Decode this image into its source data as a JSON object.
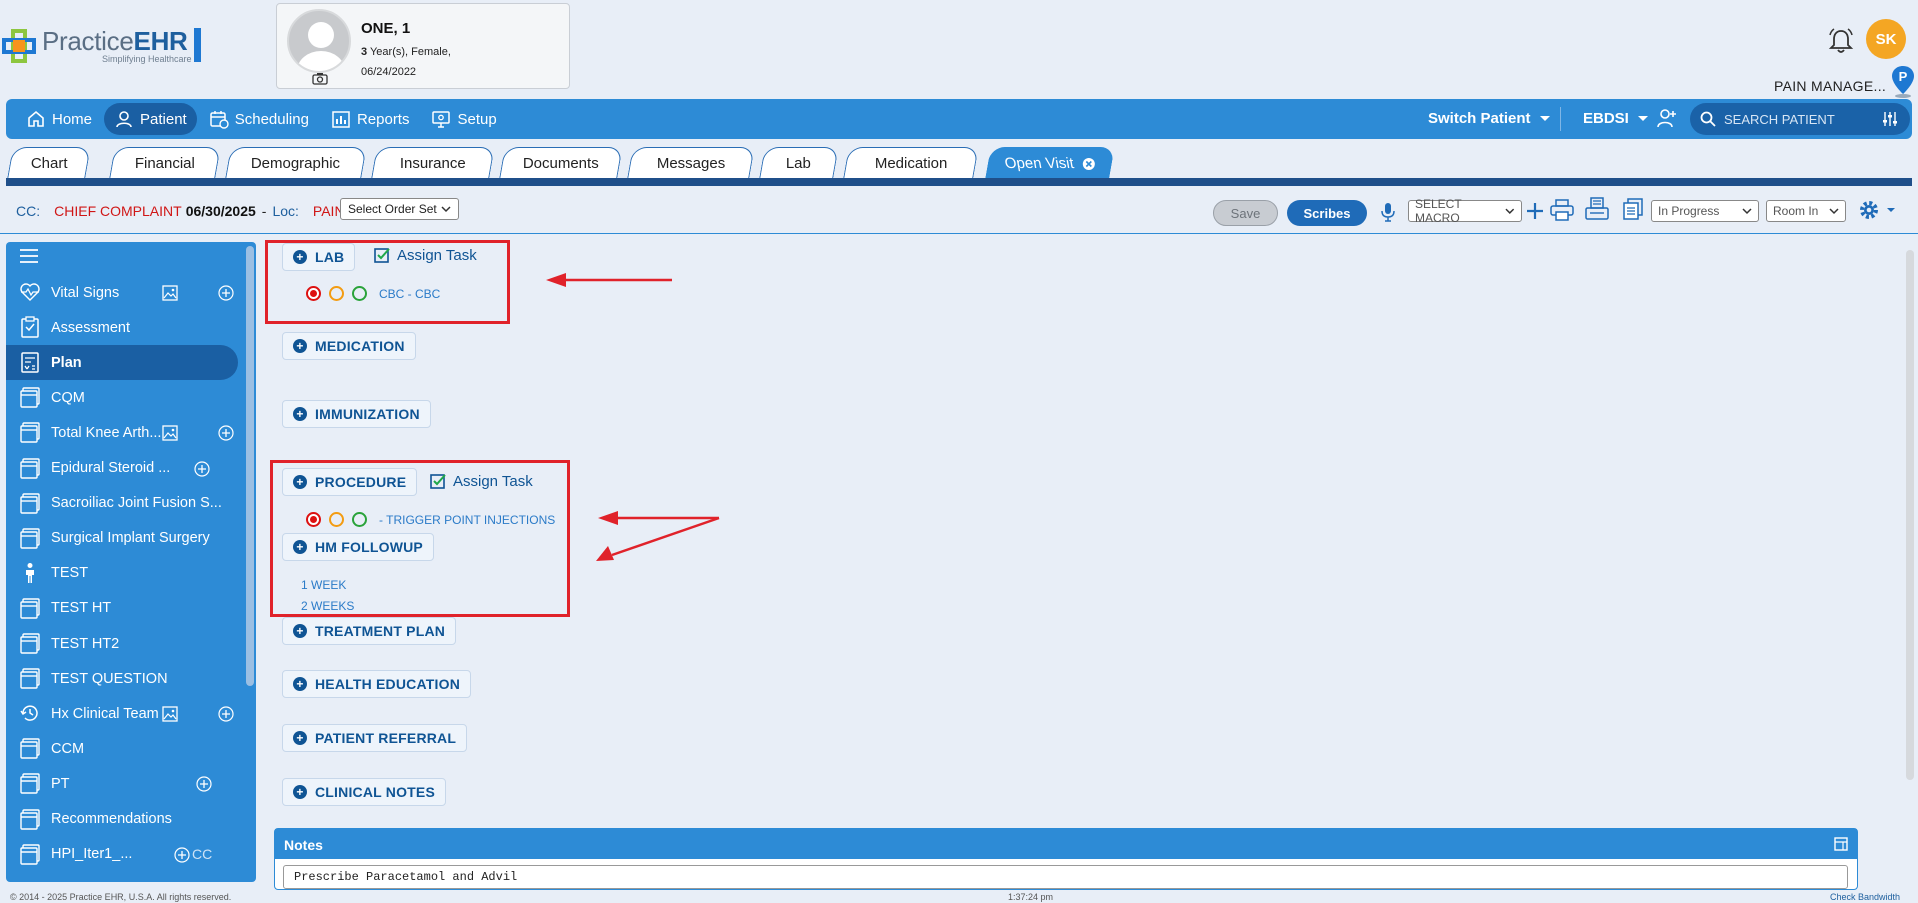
{
  "brand": {
    "name_a": "Practice",
    "name_b": "EHR",
    "tagline": "Simplifying Healthcare"
  },
  "patient": {
    "name": "ONE, 1",
    "age_num": "3",
    "age_rest": " Year(s), ",
    "gender": "Female",
    "dob": "06/24/2022"
  },
  "user": {
    "initials": "SK",
    "practice": "PAIN MANAGE...",
    "pin_letter": "P"
  },
  "nav": {
    "items": [
      {
        "label": "Home",
        "icon": "home-icon"
      },
      {
        "label": "Patient",
        "icon": "patient-icon",
        "active": true
      },
      {
        "label": "Scheduling",
        "icon": "scheduling-icon"
      },
      {
        "label": "Reports",
        "icon": "reports-icon"
      },
      {
        "label": "Setup",
        "icon": "setup-icon"
      }
    ],
    "switch_patient": "Switch Patient",
    "location": "EBDSI",
    "search_placeholder": "SEARCH PATIENT"
  },
  "tabs": [
    "Chart",
    "Financial",
    "Demographic",
    "Insurance",
    "Documents",
    "Messages",
    "Lab",
    "Medication",
    "Open Visit"
  ],
  "toolbar": {
    "cc_label": "CC:",
    "cc_value": "CHIEF COMPLAINT",
    "date": "06/30/2025",
    "dash": "-",
    "loc_label": "Loc:",
    "loc_value": "PAIN",
    "order_set": "Select Order Set",
    "save": "Save",
    "scribes": "Scribes",
    "macro": "SELECT MACRO",
    "status": "In Progress",
    "room": "Room In"
  },
  "sidebar": {
    "items": [
      {
        "label": "Vital Signs",
        "icon": "heartbeat-icon",
        "img": true,
        "plus": true
      },
      {
        "label": "Assessment",
        "icon": "clipboard-icon"
      },
      {
        "label": "Plan",
        "icon": "plan-icon",
        "active": true
      },
      {
        "label": "CQM",
        "icon": "form-icon"
      },
      {
        "label": "Total Knee Arth...",
        "icon": "form-icon",
        "img": true,
        "plus": true
      },
      {
        "label": "Epidural Steroid ...",
        "icon": "form-icon",
        "plus": true
      },
      {
        "label": "Sacroiliac Joint Fusion S...",
        "icon": "form-icon"
      },
      {
        "label": "Surgical Implant Surgery",
        "icon": "form-icon"
      },
      {
        "label": "TEST",
        "icon": "person-icon"
      },
      {
        "label": "TEST HT",
        "icon": "form-icon"
      },
      {
        "label": "TEST HT2",
        "icon": "form-icon"
      },
      {
        "label": "TEST QUESTION",
        "icon": "form-icon"
      },
      {
        "label": "Hx Clinical Team",
        "icon": "history-icon",
        "img": true,
        "plus": true
      },
      {
        "label": "CCM",
        "icon": "form-icon"
      },
      {
        "label": "PT",
        "icon": "form-icon",
        "plus": true
      },
      {
        "label": "Recommendations",
        "icon": "form-icon"
      },
      {
        "label": "HPI_Iter1_...",
        "icon": "form-icon",
        "plus": true,
        "cc": "CC"
      }
    ]
  },
  "plan": {
    "sections": [
      "LAB",
      "MEDICATION",
      "IMMUNIZATION",
      "PROCEDURE",
      "HM FOLLOWUP",
      "TREATMENT PLAN",
      "HEALTH EDUCATION",
      "PATIENT REFERRAL",
      "CLINICAL NOTES"
    ],
    "assign_task": "Assign Task",
    "lab_item": "CBC - CBC",
    "procedure_item": "- TRIGGER POINT INJECTIONS",
    "followups": [
      "1 WEEK",
      "2 WEEKS"
    ]
  },
  "notes": {
    "title": "Notes",
    "text": "Prescribe Paracetamol and Advil"
  },
  "footer": {
    "copyright": "© 2014 - 2025 Practice EHR, U.S.A. All rights reserved.",
    "time": "1:37:24 pm",
    "bandwidth": "Check Bandwidth"
  },
  "colors": {
    "nav": "#2d8bd6",
    "nav_active": "#1a5fa3",
    "accent_red": "#d01616",
    "annotation": "#e0222a"
  }
}
